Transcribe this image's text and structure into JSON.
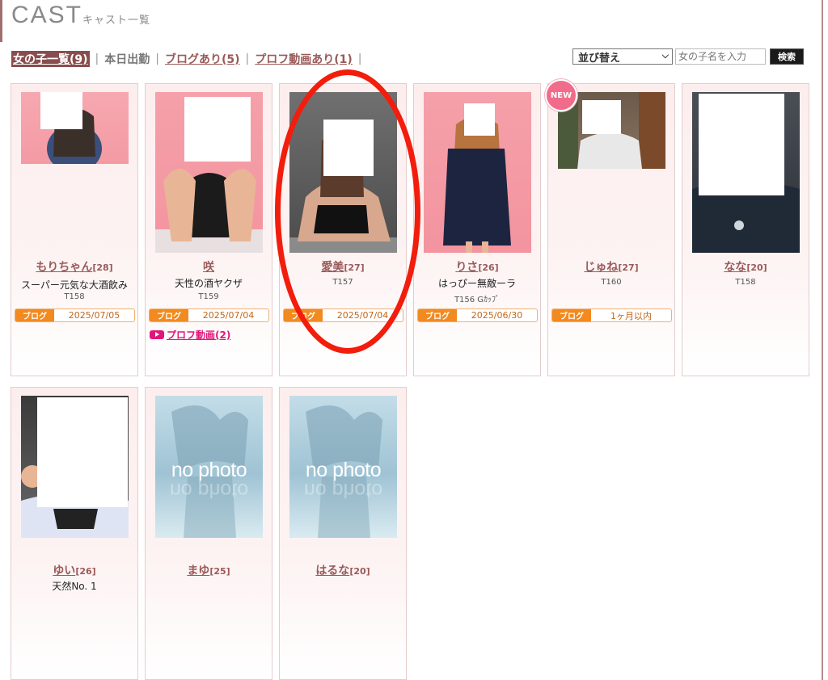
{
  "header": {
    "title": "CAST",
    "subtitle": "キャスト一覧"
  },
  "filters": [
    {
      "label": "女の子一覧(9)",
      "active": true,
      "link": true
    },
    {
      "label": "本日出勤",
      "active": false,
      "link": false
    },
    {
      "label": "ブログあり(5)",
      "active": false,
      "link": true
    },
    {
      "label": "プロフ動画あり(1)",
      "active": false,
      "link": true
    }
  ],
  "sort": {
    "selected": "並び替え"
  },
  "search": {
    "placeholder": "女の子名を入力",
    "button": "検索"
  },
  "new_badge": "NEW",
  "casts": [
    {
      "name": "もりちゃん",
      "age": "[28]",
      "catch": "スーパー元気な大酒飲み",
      "tall": "T158",
      "blog_tag": "ブログ",
      "blog_date": "2025/07/05"
    },
    {
      "name": "咲",
      "age": "",
      "catch": "天性の酒ヤクザ",
      "tall": "T159",
      "blog_tag": "ブログ",
      "blog_date": "2025/07/04",
      "video": "プロフ動画(2)"
    },
    {
      "name": "愛美",
      "age": "[27]",
      "catch": "",
      "tall": "T157",
      "blog_tag": "ブログ",
      "blog_date": "2025/07/04"
    },
    {
      "name": "りさ",
      "age": "[26]",
      "catch": "はっぴー無敵ーラ",
      "tall": "T156 Gｶｯﾌﾟ",
      "blog_tag": "ブログ",
      "blog_date": "2025/06/30"
    },
    {
      "name": "じゅね",
      "age": "[27]",
      "catch": "",
      "tall": "T160",
      "blog_tag": "ブログ",
      "blog_date": "1ヶ月以内"
    },
    {
      "name": "なな",
      "age": "[20]",
      "catch": "",
      "tall": "T158"
    },
    {
      "name": "ゆい",
      "age": "[26]",
      "catch": "天然No. 1",
      "tall": ""
    },
    {
      "name": "まゆ",
      "age": "[25]",
      "catch": "",
      "tall": "",
      "photo_text": "no photo"
    },
    {
      "name": "はるな",
      "age": "[20]",
      "catch": "",
      "tall": "",
      "photo_text": "no photo"
    }
  ]
}
